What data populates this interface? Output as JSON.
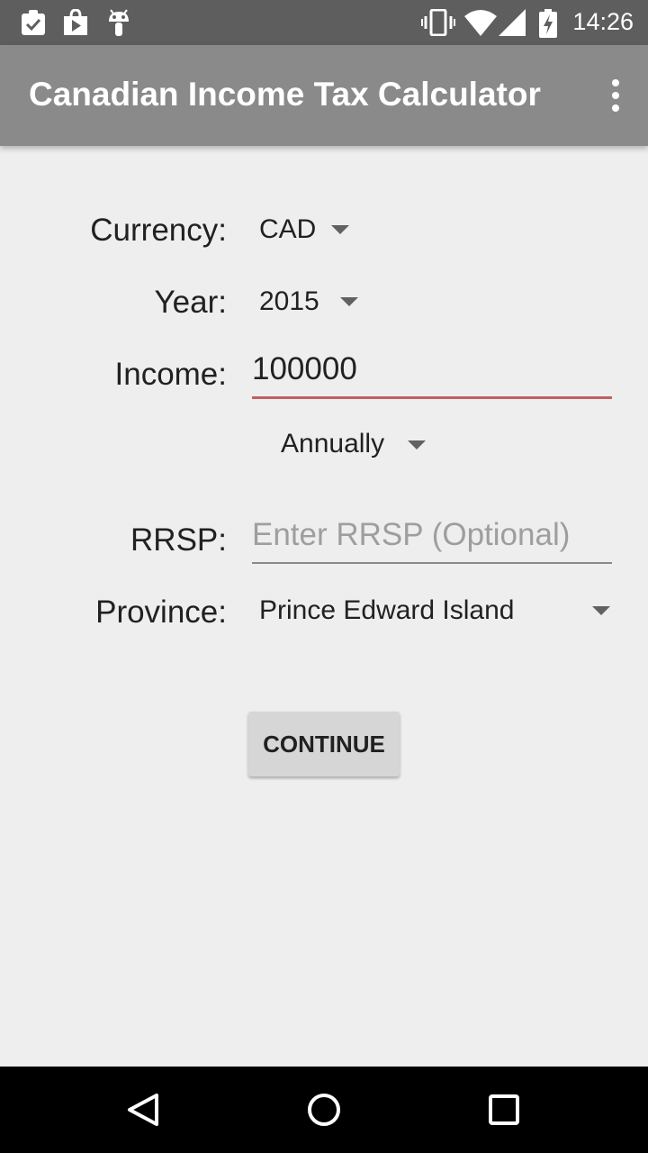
{
  "status_bar": {
    "time": "14:26",
    "icons": [
      "clipboard-check-icon",
      "play-store-icon",
      "android-icon",
      "vibrate-icon",
      "wifi-icon",
      "signal-icon",
      "battery-charging-icon"
    ]
  },
  "app_bar": {
    "title": "Canadian Income Tax Calculator",
    "overflow_icon": "more-vert-icon"
  },
  "form": {
    "currency": {
      "label": "Currency:",
      "value": "CAD"
    },
    "year": {
      "label": "Year:",
      "value": "2015"
    },
    "income": {
      "label": "Income:",
      "value": "100000"
    },
    "frequency": {
      "value": "Annually"
    },
    "rrsp": {
      "label": "RRSP:",
      "value": "",
      "placeholder": "Enter RRSP (Optional)"
    },
    "province": {
      "label": "Province:",
      "value": "Prince Edward Island"
    },
    "continue_label": "CONTINUE"
  },
  "nav_bar": {
    "icons": [
      "back-icon",
      "home-icon",
      "recents-icon"
    ]
  },
  "colors": {
    "status_bar_bg": "#5e5e5e",
    "app_bar_bg": "#8a8a8a",
    "income_underline": "#c06161",
    "page_bg": "#eeeeee"
  }
}
